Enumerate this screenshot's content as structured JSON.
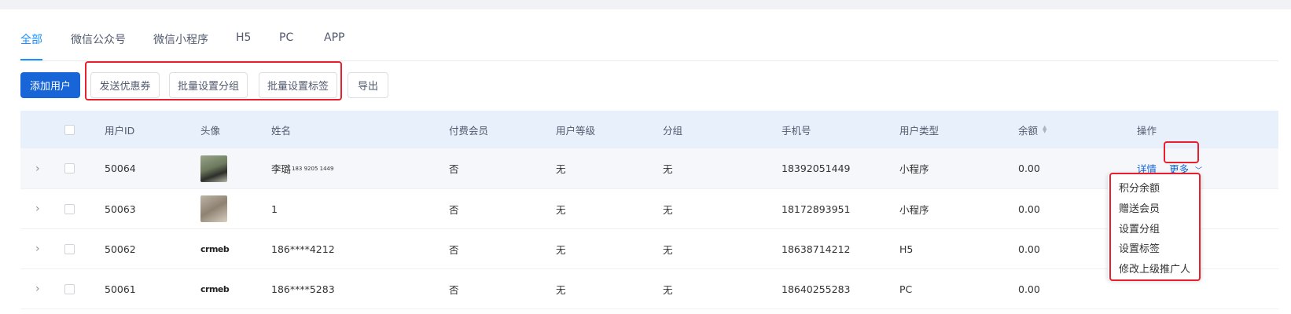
{
  "tabs": [
    {
      "label": "全部",
      "active": true
    },
    {
      "label": "微信公众号"
    },
    {
      "label": "微信小程序"
    },
    {
      "label": "H5"
    },
    {
      "label": "PC"
    },
    {
      "label": "APP"
    }
  ],
  "toolbar": {
    "add_user": "添加用户",
    "send_coupon": "发送优惠券",
    "batch_group": "批量设置分组",
    "batch_tag": "批量设置标签",
    "export": "导出"
  },
  "table": {
    "columns": {
      "user_id": "用户ID",
      "avatar": "头像",
      "name": "姓名",
      "paid_member": "付费会员",
      "level": "用户等级",
      "group": "分组",
      "phone": "手机号",
      "user_type": "用户类型",
      "balance": "余额",
      "actions": "操作"
    },
    "rows": [
      {
        "id": "50064",
        "avatar": "photo",
        "name": "李璐",
        "name_sup": "183 9205 1449",
        "paid": "否",
        "level": "无",
        "group": "无",
        "phone": "18392051449",
        "type": "小程序",
        "balance": "0.00"
      },
      {
        "id": "50063",
        "avatar": "photo",
        "name": "1",
        "paid": "否",
        "level": "无",
        "group": "无",
        "phone": "18172893951",
        "type": "小程序",
        "balance": "0.00"
      },
      {
        "id": "50062",
        "avatar": "crmeb-logo",
        "avatar_text": "crmeb",
        "name": "186****4212",
        "paid": "否",
        "level": "无",
        "group": "无",
        "phone": "18638714212",
        "type": "H5",
        "balance": "0.00"
      },
      {
        "id": "50061",
        "avatar": "crmeb-logo",
        "avatar_text": "crmeb",
        "name": "186****5283",
        "paid": "否",
        "level": "无",
        "group": "无",
        "phone": "18640255283",
        "type": "PC",
        "balance": "0.00"
      }
    ],
    "actions": {
      "detail": "详情",
      "more": "更多"
    }
  },
  "more_menu": [
    "积分余额",
    "赠送会员",
    "设置分组",
    "设置标签",
    "修改上级推广人"
  ],
  "colors": {
    "primary": "#1765d6",
    "highlight": "#e8202e",
    "header_bg": "#e8f0fb"
  }
}
